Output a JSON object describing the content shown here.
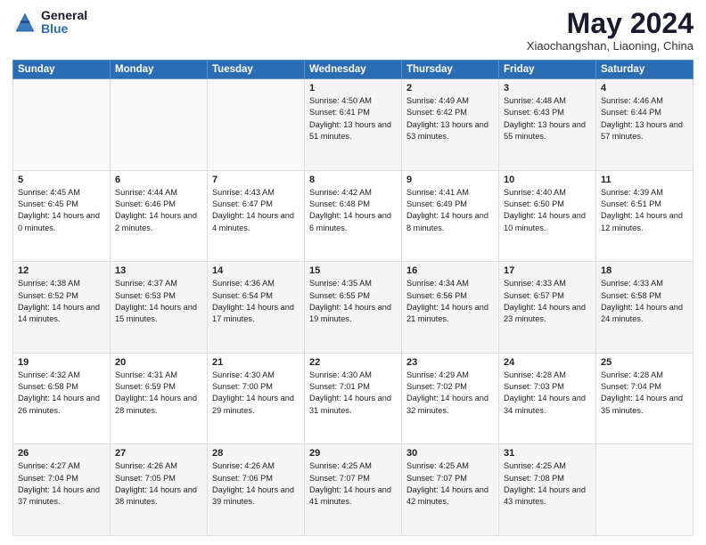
{
  "logo": {
    "general": "General",
    "blue": "Blue"
  },
  "header": {
    "month": "May 2024",
    "location": "Xiaochangshan, Liaoning, China"
  },
  "weekdays": [
    "Sunday",
    "Monday",
    "Tuesday",
    "Wednesday",
    "Thursday",
    "Friday",
    "Saturday"
  ],
  "weeks": [
    [
      {
        "day": "",
        "info": ""
      },
      {
        "day": "",
        "info": ""
      },
      {
        "day": "",
        "info": ""
      },
      {
        "day": "1",
        "info": "Sunrise: 4:50 AM\nSunset: 6:41 PM\nDaylight: 13 hours and 51 minutes."
      },
      {
        "day": "2",
        "info": "Sunrise: 4:49 AM\nSunset: 6:42 PM\nDaylight: 13 hours and 53 minutes."
      },
      {
        "day": "3",
        "info": "Sunrise: 4:48 AM\nSunset: 6:43 PM\nDaylight: 13 hours and 55 minutes."
      },
      {
        "day": "4",
        "info": "Sunrise: 4:46 AM\nSunset: 6:44 PM\nDaylight: 13 hours and 57 minutes."
      }
    ],
    [
      {
        "day": "5",
        "info": "Sunrise: 4:45 AM\nSunset: 6:45 PM\nDaylight: 14 hours and 0 minutes."
      },
      {
        "day": "6",
        "info": "Sunrise: 4:44 AM\nSunset: 6:46 PM\nDaylight: 14 hours and 2 minutes."
      },
      {
        "day": "7",
        "info": "Sunrise: 4:43 AM\nSunset: 6:47 PM\nDaylight: 14 hours and 4 minutes."
      },
      {
        "day": "8",
        "info": "Sunrise: 4:42 AM\nSunset: 6:48 PM\nDaylight: 14 hours and 6 minutes."
      },
      {
        "day": "9",
        "info": "Sunrise: 4:41 AM\nSunset: 6:49 PM\nDaylight: 14 hours and 8 minutes."
      },
      {
        "day": "10",
        "info": "Sunrise: 4:40 AM\nSunset: 6:50 PM\nDaylight: 14 hours and 10 minutes."
      },
      {
        "day": "11",
        "info": "Sunrise: 4:39 AM\nSunset: 6:51 PM\nDaylight: 14 hours and 12 minutes."
      }
    ],
    [
      {
        "day": "12",
        "info": "Sunrise: 4:38 AM\nSunset: 6:52 PM\nDaylight: 14 hours and 14 minutes."
      },
      {
        "day": "13",
        "info": "Sunrise: 4:37 AM\nSunset: 6:53 PM\nDaylight: 14 hours and 15 minutes."
      },
      {
        "day": "14",
        "info": "Sunrise: 4:36 AM\nSunset: 6:54 PM\nDaylight: 14 hours and 17 minutes."
      },
      {
        "day": "15",
        "info": "Sunrise: 4:35 AM\nSunset: 6:55 PM\nDaylight: 14 hours and 19 minutes."
      },
      {
        "day": "16",
        "info": "Sunrise: 4:34 AM\nSunset: 6:56 PM\nDaylight: 14 hours and 21 minutes."
      },
      {
        "day": "17",
        "info": "Sunrise: 4:33 AM\nSunset: 6:57 PM\nDaylight: 14 hours and 23 minutes."
      },
      {
        "day": "18",
        "info": "Sunrise: 4:33 AM\nSunset: 6:58 PM\nDaylight: 14 hours and 24 minutes."
      }
    ],
    [
      {
        "day": "19",
        "info": "Sunrise: 4:32 AM\nSunset: 6:58 PM\nDaylight: 14 hours and 26 minutes."
      },
      {
        "day": "20",
        "info": "Sunrise: 4:31 AM\nSunset: 6:59 PM\nDaylight: 14 hours and 28 minutes."
      },
      {
        "day": "21",
        "info": "Sunrise: 4:30 AM\nSunset: 7:00 PM\nDaylight: 14 hours and 29 minutes."
      },
      {
        "day": "22",
        "info": "Sunrise: 4:30 AM\nSunset: 7:01 PM\nDaylight: 14 hours and 31 minutes."
      },
      {
        "day": "23",
        "info": "Sunrise: 4:29 AM\nSunset: 7:02 PM\nDaylight: 14 hours and 32 minutes."
      },
      {
        "day": "24",
        "info": "Sunrise: 4:28 AM\nSunset: 7:03 PM\nDaylight: 14 hours and 34 minutes."
      },
      {
        "day": "25",
        "info": "Sunrise: 4:28 AM\nSunset: 7:04 PM\nDaylight: 14 hours and 35 minutes."
      }
    ],
    [
      {
        "day": "26",
        "info": "Sunrise: 4:27 AM\nSunset: 7:04 PM\nDaylight: 14 hours and 37 minutes."
      },
      {
        "day": "27",
        "info": "Sunrise: 4:26 AM\nSunset: 7:05 PM\nDaylight: 14 hours and 38 minutes."
      },
      {
        "day": "28",
        "info": "Sunrise: 4:26 AM\nSunset: 7:06 PM\nDaylight: 14 hours and 39 minutes."
      },
      {
        "day": "29",
        "info": "Sunrise: 4:25 AM\nSunset: 7:07 PM\nDaylight: 14 hours and 41 minutes."
      },
      {
        "day": "30",
        "info": "Sunrise: 4:25 AM\nSunset: 7:07 PM\nDaylight: 14 hours and 42 minutes."
      },
      {
        "day": "31",
        "info": "Sunrise: 4:25 AM\nSunset: 7:08 PM\nDaylight: 14 hours and 43 minutes."
      },
      {
        "day": "",
        "info": ""
      }
    ]
  ]
}
